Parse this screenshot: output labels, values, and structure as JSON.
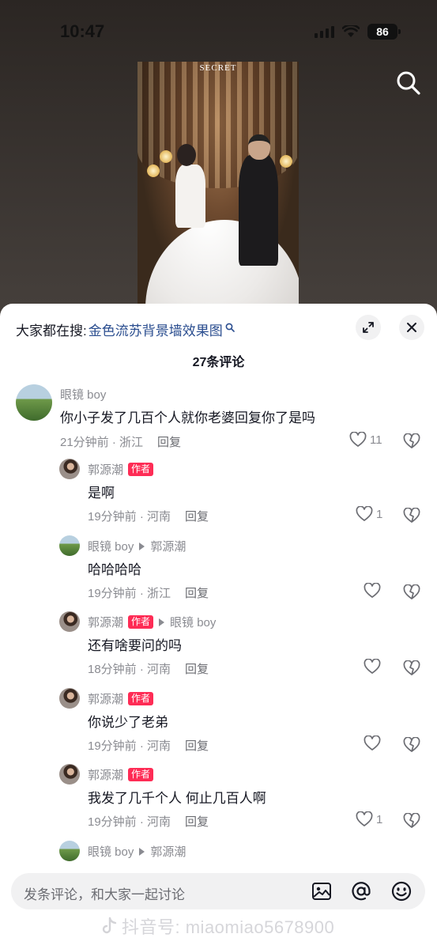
{
  "status_bar": {
    "time": "10:47",
    "battery": "86"
  },
  "video": {
    "logo_text": "SECRET"
  },
  "sheet": {
    "hot_search_prefix": "大家都在搜:",
    "hot_search_term": "金色流苏背景墙效果图",
    "comment_count": "27条评论"
  },
  "comments": [
    {
      "user": "眼镜 boy",
      "text": "你小子发了几百个人就你老婆回复你了是吗",
      "time_loc": "21分钟前 · 浙江",
      "reply": "回复",
      "likes": "11"
    },
    {
      "user": "郭源潮",
      "author_tag": "作者",
      "text": "是啊",
      "time_loc": "19分钟前 · 河南",
      "reply": "回复",
      "likes": "1"
    },
    {
      "user": "眼镜 boy",
      "reply_to": "郭源潮",
      "text": "哈哈哈哈",
      "time_loc": "19分钟前 · 浙江",
      "reply": "回复",
      "likes": ""
    },
    {
      "user": "郭源潮",
      "author_tag": "作者",
      "reply_to": "眼镜 boy",
      "text": "还有啥要问的吗",
      "time_loc": "18分钟前 · 河南",
      "reply": "回复",
      "likes": ""
    },
    {
      "user": "郭源潮",
      "author_tag": "作者",
      "text": "你说少了老弟",
      "time_loc": "19分钟前 · 河南",
      "reply": "回复",
      "likes": ""
    },
    {
      "user": "郭源潮",
      "author_tag": "作者",
      "text": "我发了几千个人 何止几百人啊",
      "time_loc": "19分钟前 · 河南",
      "reply": "回复",
      "likes": "1"
    },
    {
      "user": "眼镜 boy",
      "reply_to": "郭源潮"
    }
  ],
  "input": {
    "placeholder": "发条评论，和大家一起讨论",
    "icons": [
      "image-icon",
      "at-icon",
      "emoji-icon"
    ]
  },
  "watermark": "抖音号: miaomiao5678900"
}
